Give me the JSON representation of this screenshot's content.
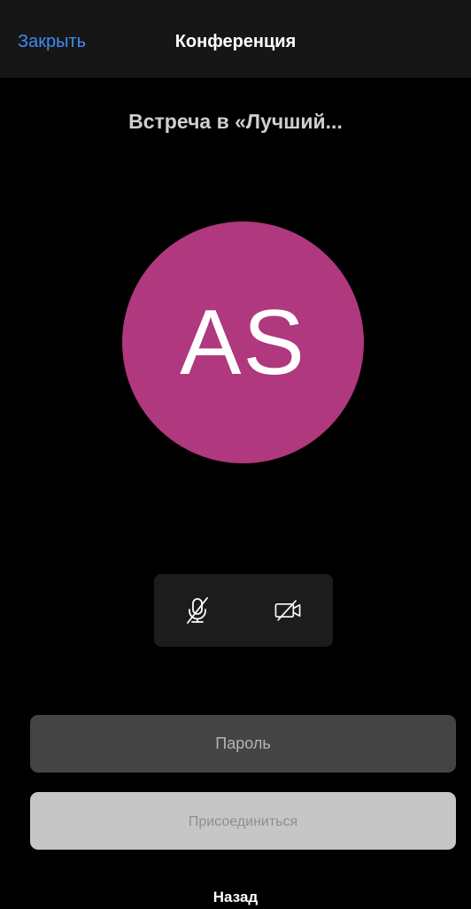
{
  "nav": {
    "close_label": "Закрыть",
    "title": "Конференция"
  },
  "meeting": {
    "title": "Встреча в «Лучший..."
  },
  "avatar": {
    "initials": "AS",
    "color": "#b0387e"
  },
  "media_controls": {
    "mic_icon": "microphone-muted-icon",
    "camera_icon": "camera-off-icon"
  },
  "password": {
    "placeholder": "Пароль",
    "value": ""
  },
  "join_button": {
    "label": "Присоединиться"
  },
  "back_link": {
    "label": "Назад"
  },
  "colors": {
    "accent": "#3d8df5",
    "background": "#000000",
    "nav_background": "#161616"
  }
}
